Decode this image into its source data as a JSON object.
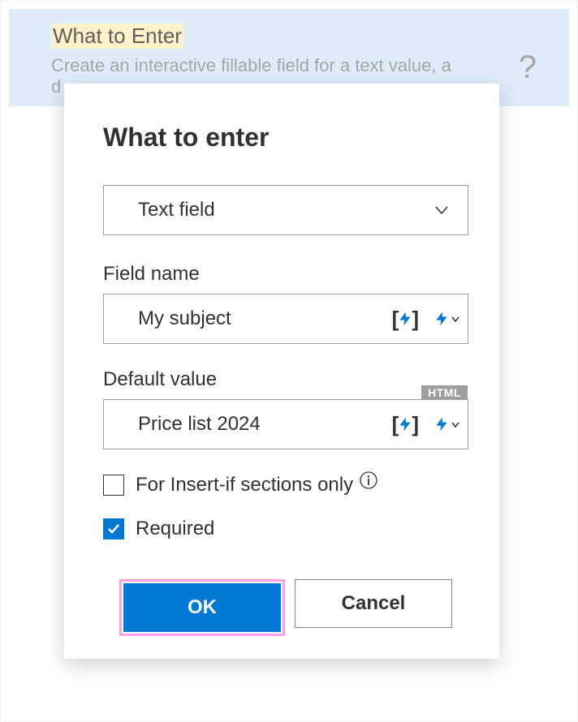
{
  "bg": {
    "title": "What to Enter",
    "desc": "Create an interactive fillable field for a text value, a d"
  },
  "dialog": {
    "title": "What to enter",
    "type_select": "Text field",
    "field_name_label": "Field name",
    "field_name_value": "My subject",
    "default_value_label": "Default value",
    "default_value_badge": "HTML",
    "default_value_value": "Price list 2024",
    "insert_if_label": "For Insert-if sections only",
    "required_label": "Required",
    "ok_label": "OK",
    "cancel_label": "Cancel"
  }
}
